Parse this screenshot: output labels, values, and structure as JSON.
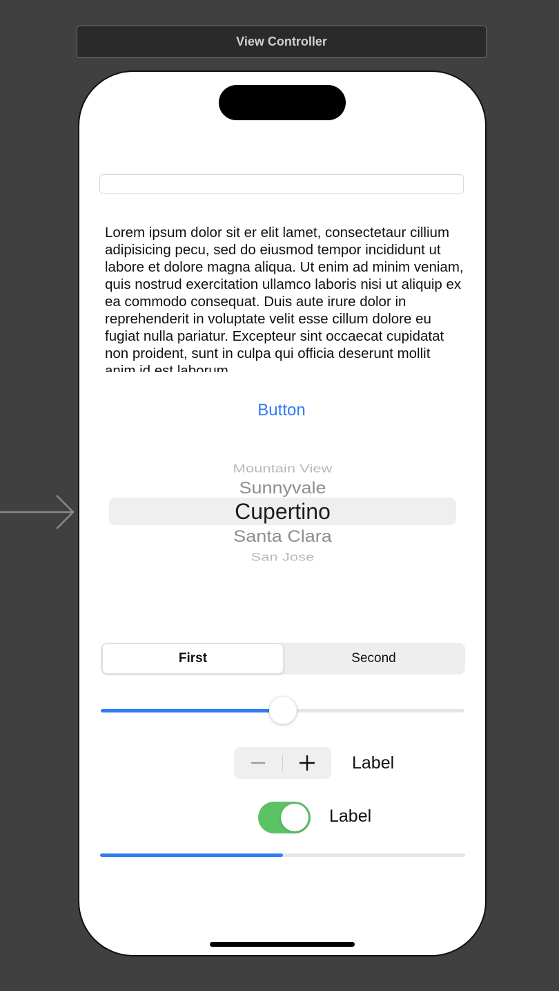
{
  "scene": {
    "title": "View Controller"
  },
  "text_field": {
    "value": "",
    "placeholder": ""
  },
  "text_view": {
    "text": "Lorem ipsum dolor sit er elit lamet, consectetaur cillium adipisicing pecu, sed do eiusmod tempor incididunt ut labore et dolore magna aliqua. Ut enim ad minim veniam, quis nostrud exercitation ullamco laboris nisi ut aliquip ex ea commodo consequat. Duis aute irure dolor in reprehenderit in voluptate velit esse cillum dolore eu fugiat nulla pariatur. Excepteur sint occaecat cupidatat non proident, sunt in culpa qui officia deserunt mollit anim id est laborum."
  },
  "button": {
    "label": "Button"
  },
  "picker": {
    "items": [
      "Mountain View",
      "Sunnyvale",
      "Cupertino",
      "Santa Clara",
      "San Jose"
    ],
    "selected": "Cupertino"
  },
  "segmented": {
    "segments": [
      "First",
      "Second"
    ],
    "selected_index": 0
  },
  "slider": {
    "value": 0.5
  },
  "stepper": {
    "minus_symbol": "−",
    "plus_symbol": "+",
    "label": "Label"
  },
  "switch": {
    "on": true,
    "label": "Label"
  },
  "progress": {
    "value": 0.5
  },
  "colors": {
    "tint": "#2f7cf6",
    "switch_on": "#5cc365",
    "canvas_background": "#404040"
  }
}
